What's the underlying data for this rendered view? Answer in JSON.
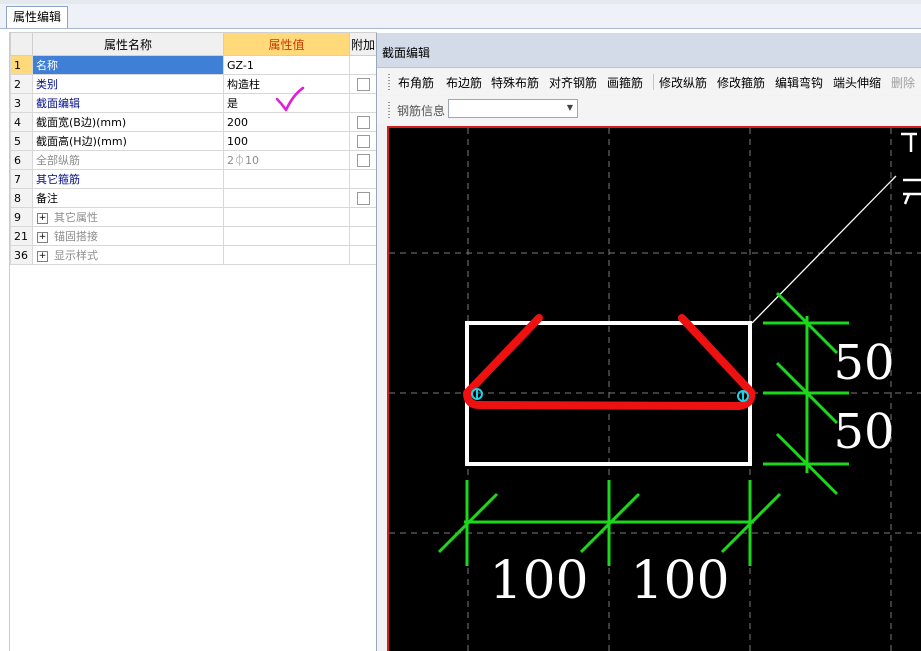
{
  "top_tab": "属性编辑",
  "grid": {
    "headers": {
      "name": "属性名称",
      "value": "属性值",
      "extra": "附加"
    },
    "rows": [
      {
        "num": "1",
        "name": "名称",
        "value": "GZ-1",
        "style": "selected",
        "checkbox": false,
        "group": false
      },
      {
        "num": "2",
        "name": "类别",
        "value": "构造柱",
        "style": "blue",
        "checkbox": true,
        "group": false
      },
      {
        "num": "3",
        "name": "截面编辑",
        "value": "是",
        "style": "blue",
        "checkbox": false,
        "group": false
      },
      {
        "num": "4",
        "name": "截面宽(B边)(mm)",
        "value": "200",
        "style": "normal",
        "checkbox": true,
        "group": false
      },
      {
        "num": "5",
        "name": "截面高(H边)(mm)",
        "value": "100",
        "style": "normal",
        "checkbox": true,
        "group": false
      },
      {
        "num": "6",
        "name": "全部纵筋",
        "value": "2⏀10",
        "style": "gray",
        "checkbox": true,
        "group": false
      },
      {
        "num": "7",
        "name": "其它箍筋",
        "value": "",
        "style": "blue",
        "checkbox": false,
        "group": false
      },
      {
        "num": "8",
        "name": "备注",
        "value": "",
        "style": "normal",
        "checkbox": true,
        "group": false
      },
      {
        "num": "9",
        "name": "其它属性",
        "value": "",
        "style": "gray",
        "checkbox": false,
        "group": true
      },
      {
        "num": "21",
        "name": "锚固搭接",
        "value": "",
        "style": "gray",
        "checkbox": false,
        "group": true
      },
      {
        "num": "36",
        "name": "显示样式",
        "value": "",
        "style": "gray",
        "checkbox": false,
        "group": true
      }
    ]
  },
  "editor": {
    "title": "截面编辑",
    "toolbar": [
      {
        "label": "布角筋",
        "enabled": true
      },
      {
        "label": "布边筋",
        "enabled": true
      },
      {
        "label": "特殊布筋",
        "enabled": true
      },
      {
        "label": "对齐钢筋",
        "enabled": true
      },
      {
        "label": "画箍筋",
        "enabled": true
      },
      {
        "label": "修改纵筋",
        "enabled": true
      },
      {
        "label": "修改箍筋",
        "enabled": true
      },
      {
        "label": "编辑弯钩",
        "enabled": true
      },
      {
        "label": "端头伸缩",
        "enabled": true
      },
      {
        "label": "删除",
        "enabled": false
      }
    ],
    "rebar_info_label": "钢筋信息",
    "rebar_info_value": "",
    "drawing": {
      "dims_bottom": [
        "100",
        "100"
      ],
      "dims_right": [
        "50",
        "50"
      ],
      "colors": {
        "background": "#000000",
        "section": "#ffffff",
        "rebar": "#ee1111",
        "dimension": "#1bd81b",
        "node": "#19d3e6",
        "frame": "#d21f1f",
        "check": "#e020d8"
      }
    }
  }
}
